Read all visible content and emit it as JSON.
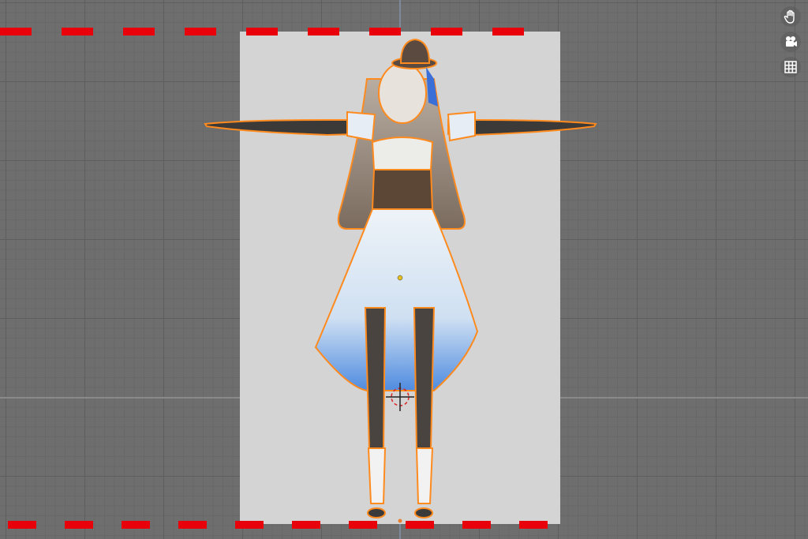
{
  "viewport": {
    "grid_color": "#6e6e6e",
    "camera_frame_color": "#d4d4d4",
    "frame_border_color": "#e8000a",
    "selection_outline_color": "#ff8a1e"
  },
  "nav_gizmo": {
    "items": [
      {
        "name": "hand-pan-icon"
      },
      {
        "name": "camera-icon"
      },
      {
        "name": "grid-view-icon"
      }
    ]
  }
}
